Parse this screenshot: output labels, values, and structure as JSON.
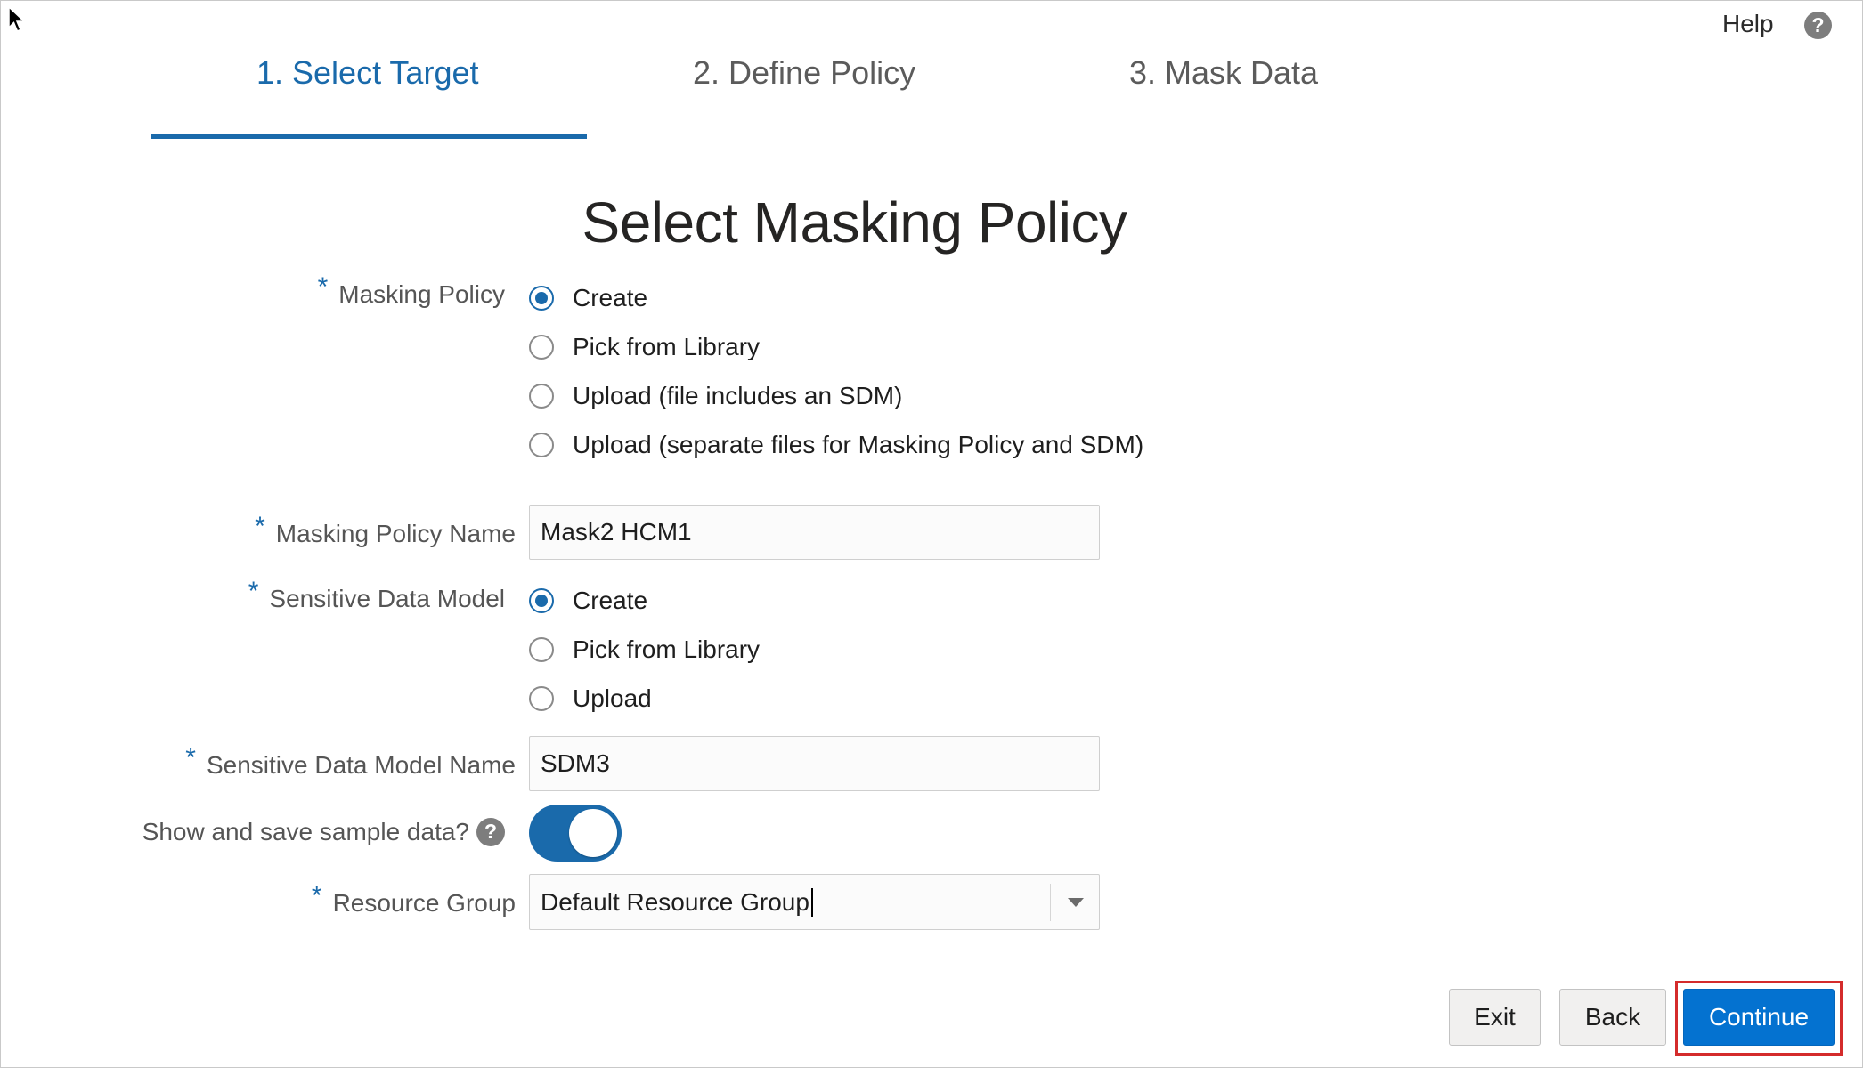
{
  "header": {
    "help_label": "Help",
    "help_icon": "question-circle-icon"
  },
  "steps": [
    {
      "label": "1. Select Target",
      "active": true
    },
    {
      "label": "2. Define Policy",
      "active": false
    },
    {
      "label": "3. Mask Data",
      "active": false
    }
  ],
  "page_title": "Select Masking Policy",
  "form": {
    "required_mark": "*",
    "masking_policy": {
      "label": "Masking Policy",
      "selected": "Create",
      "options": [
        "Create",
        "Pick from Library",
        "Upload (file includes an SDM)",
        "Upload (separate files for Masking Policy and SDM)"
      ]
    },
    "masking_policy_name": {
      "label": "Masking Policy Name",
      "value": "Mask2 HCM1"
    },
    "sensitive_data_model": {
      "label": "Sensitive Data Model",
      "selected": "Create",
      "options": [
        "Create",
        "Pick from Library",
        "Upload"
      ]
    },
    "sdm_name": {
      "label": "Sensitive Data Model Name",
      "value": "SDM3"
    },
    "sample_data": {
      "label": "Show and save sample data?",
      "help_glyph": "?",
      "enabled": true
    },
    "resource_group": {
      "label": "Resource Group",
      "value": "Default Resource Group"
    }
  },
  "footer": {
    "exit_label": "Exit",
    "back_label": "Back",
    "continue_label": "Continue"
  },
  "colors": {
    "accent": "#1a6aab",
    "primary_button": "#0472d0",
    "highlight": "#d42b2b"
  }
}
